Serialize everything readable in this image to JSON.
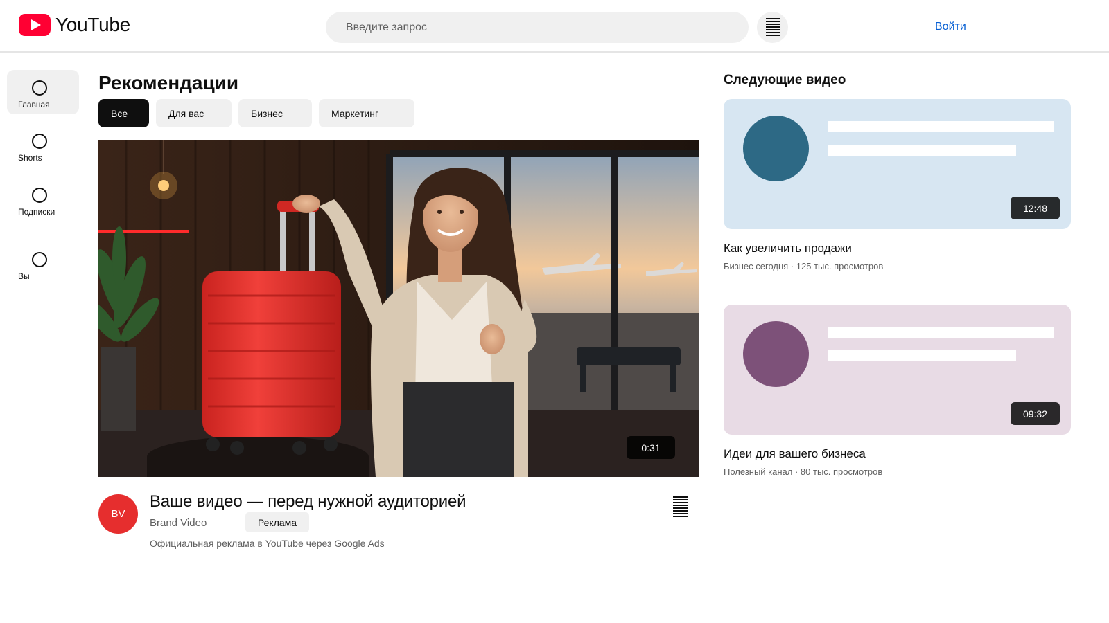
{
  "header": {
    "logo_text": "YouTube",
    "search_placeholder": "Введите запрос",
    "signin_label": "Войти"
  },
  "sidebar": {
    "items": [
      {
        "label": "Главная",
        "active": true
      },
      {
        "label": "Shorts",
        "active": false
      },
      {
        "label": "Подписки",
        "active": false
      },
      {
        "label": "Вы",
        "active": false
      }
    ]
  },
  "main": {
    "section_title": "Рекомендации",
    "chips": [
      {
        "label": "Все",
        "active": true
      },
      {
        "label": "Для вас",
        "active": false
      },
      {
        "label": "Бизнес",
        "active": false
      },
      {
        "label": "Маркетинг",
        "active": false
      }
    ],
    "video": {
      "duration": "0:31",
      "avatar_initials": "BV",
      "title": "Ваше видео — перед нужной аудиторией",
      "channel": "Brand Video",
      "badge": "Реклама",
      "description": "Официальная реклама в YouTube через Google Ads"
    }
  },
  "up_next": {
    "title": "Следующие видео",
    "cards": [
      {
        "duration": "12:48",
        "title": "Как увеличить продажи",
        "meta": "Бизнес сегодня · 125 тыс. просмотров",
        "bg_color": "#d7e6f2",
        "circle_color": "#2d6985"
      },
      {
        "duration": "09:32",
        "title": "Идеи для вашего бизнеса",
        "meta": "Полезный канал · 80 тыс. просмотров",
        "bg_color": "#e8dbe5",
        "circle_color": "#7d5179"
      }
    ]
  },
  "colors": {
    "brand_red": "#ff0033",
    "link_blue": "#065fd4",
    "avatar_red": "#e62e2e"
  }
}
